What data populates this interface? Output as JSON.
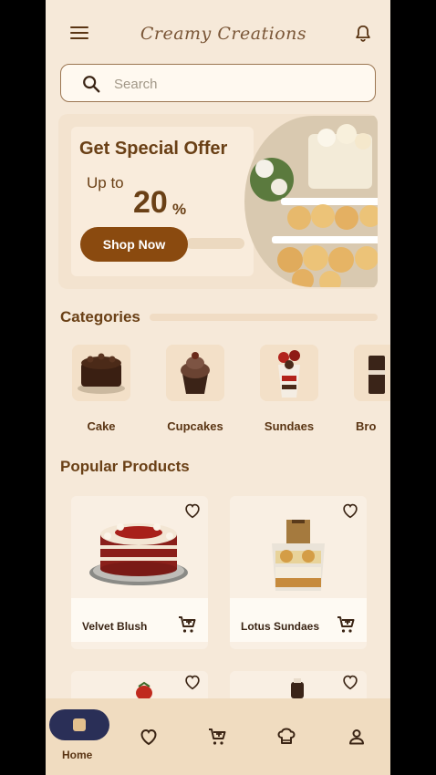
{
  "app": {
    "title": "Creamy Creations"
  },
  "header": {
    "menu_icon": "menu-icon",
    "notification_icon": "bell-icon"
  },
  "search": {
    "placeholder": "Search",
    "icon": "search-icon"
  },
  "banner": {
    "title": "Get Special Offer",
    "upto": "Up to",
    "percent": "20",
    "percent_sign": "%",
    "button": "Shop Now"
  },
  "categories": {
    "title": "Categories",
    "items": [
      {
        "label": "Cake"
      },
      {
        "label": "Cupcakes"
      },
      {
        "label": "Sundaes"
      },
      {
        "label": "Bro"
      }
    ]
  },
  "popular": {
    "title": "Popular Products",
    "products": [
      {
        "name": "Velvet Blush"
      },
      {
        "name": "Lotus Sundaes"
      }
    ]
  },
  "bottom_nav": {
    "items": [
      {
        "label": "Home",
        "icon": "home-icon",
        "active": true
      },
      {
        "label": "",
        "icon": "heart-icon"
      },
      {
        "label": "",
        "icon": "cart-icon"
      },
      {
        "label": "",
        "icon": "chef-hat-icon"
      },
      {
        "label": "",
        "icon": "profile-icon"
      }
    ]
  },
  "colors": {
    "background": "#f6e9d9",
    "accent": "#8a4a0f",
    "text": "#6a4016",
    "nav_active": "#2a2f57"
  }
}
